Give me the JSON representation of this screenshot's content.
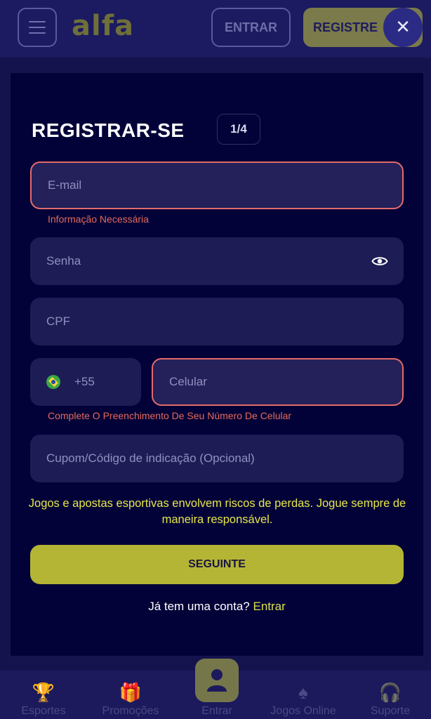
{
  "header": {
    "logo": "alfa",
    "login_label": "ENTRAR",
    "register_label": "REGISTRE",
    "close_symbol": "✕"
  },
  "modal": {
    "title": "REGISTRAR-SE",
    "step": "1/4",
    "email_placeholder": "E-mail",
    "email_error": "Informação Necessária",
    "password_placeholder": "Senha",
    "cpf_placeholder": "CPF",
    "country_code": "+55",
    "phone_placeholder": "Celular",
    "phone_error": "Complete O Preenchimento De Seu Número De Celular",
    "coupon_placeholder": "Cupom/Código de indicação (Opcional)",
    "notice": "Jogos e apostas esportivas envolvem riscos de perdas. Jogue sempre de maneira responsável.",
    "next_label": "SEGUINTE",
    "have_account": "Já tem uma conta?",
    "login_link": "Entrar"
  },
  "bottom_nav": [
    {
      "label": "Esportes",
      "icon": "trophy-icon"
    },
    {
      "label": "Promoções",
      "icon": "gift-icon"
    },
    {
      "label": "Entrar",
      "icon": "user-icon"
    },
    {
      "label": "Jogos Online",
      "icon": "spade-icon"
    },
    {
      "label": "Suporte",
      "icon": "headset-icon"
    }
  ],
  "colors": {
    "accent": "#b5b535",
    "error": "#e36b6b",
    "modal_bg": "#030238",
    "field_bg": "#1e1c55"
  }
}
